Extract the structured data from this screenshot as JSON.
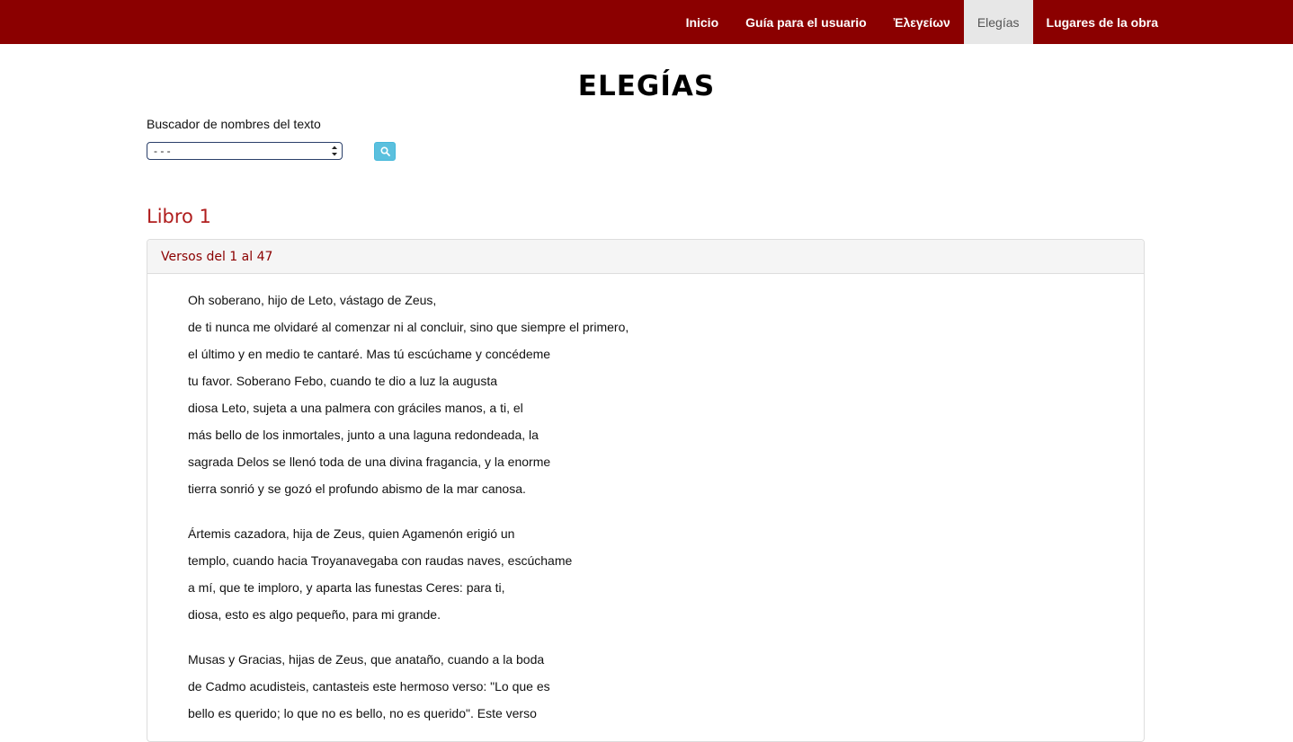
{
  "nav": {
    "items": [
      {
        "label": "Inicio",
        "active": false
      },
      {
        "label": "Guía para el usuario",
        "active": false
      },
      {
        "label": "Ἐλεγείων",
        "active": false
      },
      {
        "label": "Elegías",
        "active": true
      },
      {
        "label": "Lugares de la obra",
        "active": false
      }
    ]
  },
  "page": {
    "title": "ELEGÍAS"
  },
  "search": {
    "label": "Buscador de nombres del texto",
    "selected_value": "- - -",
    "button_icon": "search-icon"
  },
  "book": {
    "title": "Libro 1",
    "panel_heading": "Versos del 1 al 47",
    "stanzas": [
      [
        "Oh soberano, hijo de Leto, vástago de Zeus,",
        "de ti nunca me olvidaré al comenzar ni al concluir, sino que siempre el primero,",
        "el último y en medio te cantaré. Mas tú escúchame y concédeme",
        "tu favor. Soberano Febo, cuando te dio a luz la augusta",
        "diosa Leto, sujeta a una palmera con gráciles manos, a ti, el",
        "más bello de los inmortales, junto a una laguna redondeada, la",
        "sagrada Delos se llenó toda de una divina fragancia, y la enorme",
        "tierra sonrió y se gozó el profundo abismo de la mar canosa."
      ],
      [
        "Ártemis cazadora, hija de Zeus, quien Agamenón erigió un",
        "templo, cuando hacia Troyanavegaba con raudas naves, escúchame",
        "a mí, que te imploro, y aparta las funestas Ceres: para ti,",
        "diosa, esto es algo pequeño, para mi grande."
      ],
      [
        "Musas y Gracias, hijas de Zeus, que anataño, cuando a la boda",
        "de Cadmo acudisteis, cantasteis este hermoso verso: \"Lo que es",
        "bello es querido; lo que no es bello, no es querido\". Este verso"
      ]
    ]
  },
  "colors": {
    "navbar": "#8b0000",
    "active_nav_bg": "#e7e7e7",
    "book_title": "#b01e1e",
    "search_button": "#5bc0de"
  }
}
